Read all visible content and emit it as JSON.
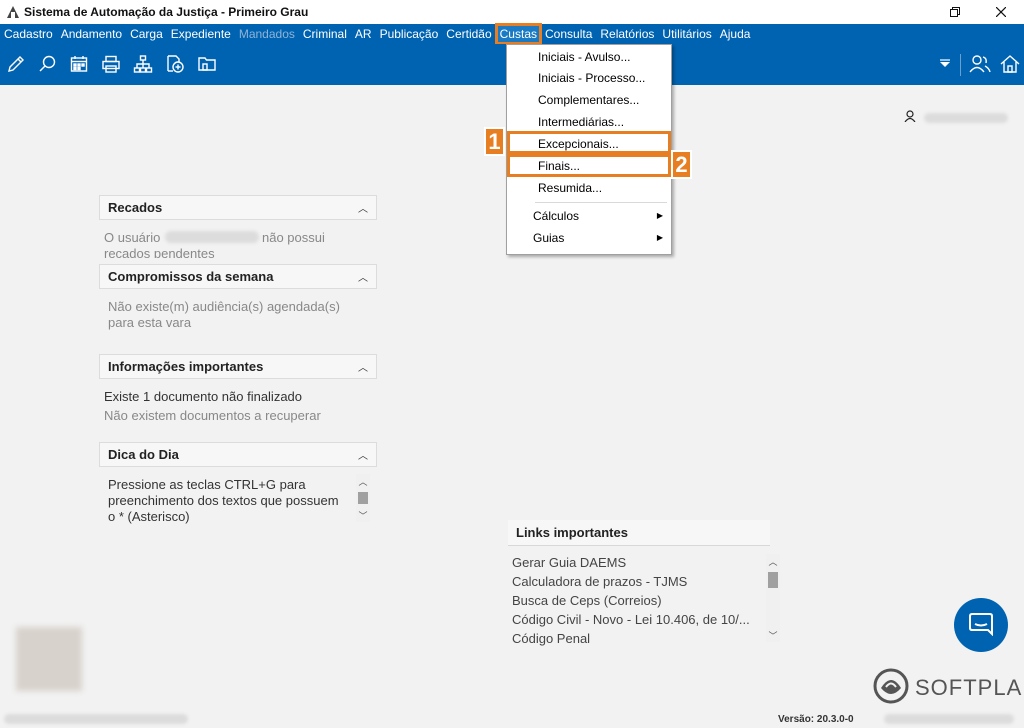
{
  "window": {
    "title": "Sistema de Automação da Justiça - Primeiro Grau"
  },
  "menubar": {
    "items": [
      {
        "label": "Cadastro"
      },
      {
        "label": "Andamento"
      },
      {
        "label": "Carga"
      },
      {
        "label": "Expediente"
      },
      {
        "label": "Mandados"
      },
      {
        "label": "Criminal"
      },
      {
        "label": "AR"
      },
      {
        "label": "Publicação"
      },
      {
        "label": "Certidão"
      },
      {
        "label": "Custas"
      },
      {
        "label": "Consulta"
      },
      {
        "label": "Relatórios"
      },
      {
        "label": "Utilitários"
      },
      {
        "label": "Ajuda"
      }
    ]
  },
  "custas_menu": {
    "items": [
      {
        "label": "Iniciais - Avulso..."
      },
      {
        "label": "Iniciais - Processo..."
      },
      {
        "label": "Complementares..."
      },
      {
        "label": "Intermediárias..."
      },
      {
        "label": "Excepcionais..."
      },
      {
        "label": "Finais..."
      },
      {
        "label": "Resumida..."
      },
      {
        "label": "Cálculos"
      },
      {
        "label": "Guias"
      }
    ],
    "badges": [
      "1",
      "2"
    ]
  },
  "panels": {
    "recados": {
      "title": "Recados",
      "text_before": "O usuário",
      "text_after": "não possui",
      "text_line2": "recados pendentes"
    },
    "compromissos": {
      "title": "Compromissos da semana",
      "line1": "Não existe(m) audiência(s) agendada(s)",
      "line2": "para esta vara"
    },
    "informacoes": {
      "title": "Informações importantes",
      "line1": "Existe 1 documento não finalizado",
      "line2": "Não existem documentos a recuperar"
    },
    "dica": {
      "title": "Dica do Dia",
      "line1": "Pressione as teclas CTRL+G para",
      "line2": "preenchimento dos textos que possuem",
      "line3": "o * (Asterisco)"
    }
  },
  "links": {
    "title": "Links importantes",
    "items": [
      "Gerar Guia DAEMS",
      "Calculadora de prazos - TJMS",
      "Busca de Ceps (Correios)",
      "Código Civil - Novo - Lei 10.406, de 10/...",
      "Código Penal"
    ]
  },
  "brand": {
    "name": "SOFTPLAN"
  },
  "status": {
    "version": "Versão: 20.3.0-0"
  },
  "colors": {
    "menubar_bg": "#0063b1",
    "highlight": "#e87e22"
  }
}
